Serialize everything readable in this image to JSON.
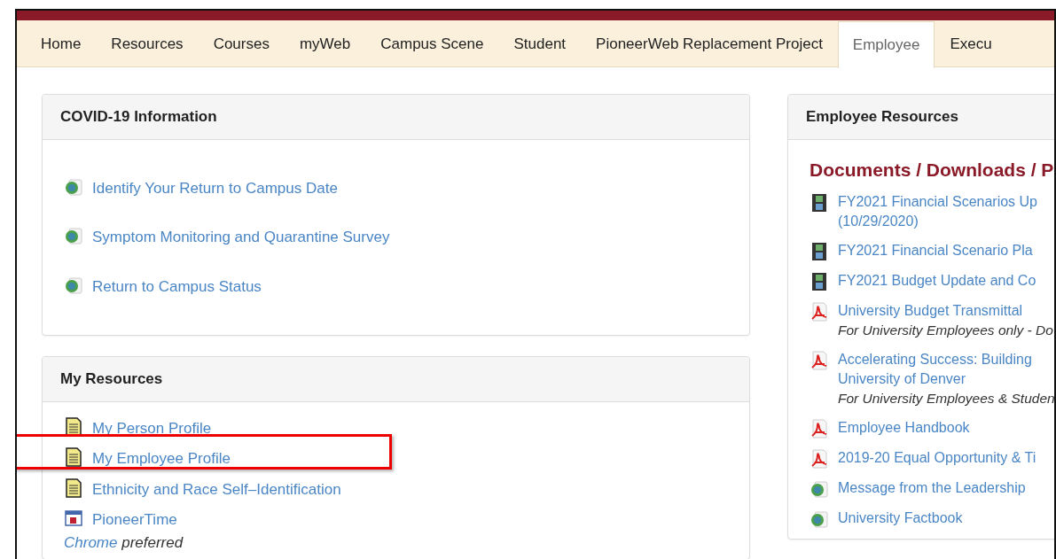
{
  "tabs": [
    {
      "label": "Home",
      "selected": false
    },
    {
      "label": "Resources",
      "selected": false
    },
    {
      "label": "Courses",
      "selected": false
    },
    {
      "label": "myWeb",
      "selected": false
    },
    {
      "label": "Campus Scene",
      "selected": false
    },
    {
      "label": "Student",
      "selected": false
    },
    {
      "label": "PioneerWeb Replacement Project",
      "selected": false
    },
    {
      "label": "Employee",
      "selected": true
    },
    {
      "label": "Execu",
      "selected": false
    }
  ],
  "covid_card": {
    "title": "COVID-19 Information",
    "links": [
      {
        "kind": "globe",
        "lines": [
          "Identify Your Return to Campus Date"
        ]
      },
      {
        "kind": "globe",
        "lines": [
          "Symptom Monitoring and Quarantine Survey"
        ]
      },
      {
        "kind": "globe",
        "lines": [
          "Return to Campus Status"
        ]
      }
    ]
  },
  "resources_card": {
    "title": "My Resources",
    "links": [
      {
        "kind": "doc",
        "lines": [
          "My Person Profile"
        ],
        "highlighted": false
      },
      {
        "kind": "doc",
        "lines": [
          "My Employee Profile"
        ],
        "highlighted": true
      },
      {
        "kind": "doc",
        "lines": [
          "Ethnicity and Race Self–Identification"
        ],
        "highlighted": false
      },
      {
        "kind": "calendar",
        "lines": [
          "PioneerTime"
        ],
        "highlighted": false,
        "note_link": "Chrome",
        "note": "preferred"
      }
    ]
  },
  "employee_card": {
    "title": "Employee Resources",
    "section_heading": "Documents / Downloads / P",
    "links": [
      {
        "kind": "film",
        "lines": [
          "FY2021 Financial Scenarios Up",
          "(10/29/2020)"
        ]
      },
      {
        "kind": "film",
        "lines": [
          "FY2021 Financial Scenario Pla"
        ]
      },
      {
        "kind": "film",
        "lines": [
          "FY2021 Budget Update and Co"
        ]
      },
      {
        "kind": "pdf",
        "lines": [
          "University Budget Transmittal"
        ],
        "note": "For University Employees only - Do"
      },
      {
        "kind": "pdf",
        "lines": [
          "Accelerating Success: Building",
          "University of Denver"
        ],
        "note": "For University Employees & Studen"
      },
      {
        "kind": "pdf",
        "lines": [
          "Employee Handbook"
        ]
      },
      {
        "kind": "pdf",
        "lines": [
          "2019-20 Equal Opportunity & Ti"
        ]
      },
      {
        "kind": "globe",
        "lines": [
          "Message from the Leadership"
        ]
      },
      {
        "kind": "globe",
        "lines": [
          "University Factbook"
        ]
      }
    ]
  }
}
